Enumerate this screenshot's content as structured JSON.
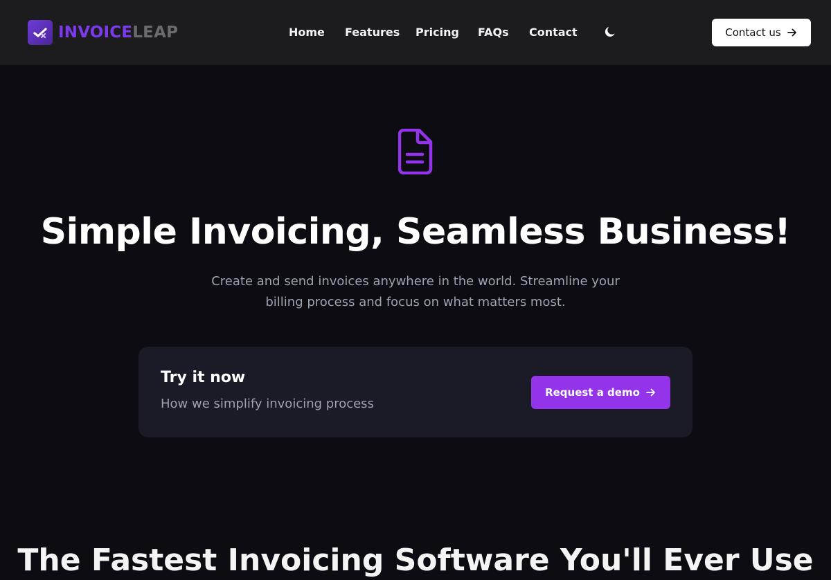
{
  "brand": {
    "name_part1": "INVOICE",
    "name_part2": "LEAP",
    "icon": "logo-mark-icon",
    "primary_color": "#7c3aed",
    "secondary_color": "#6b6b70"
  },
  "nav": {
    "links": [
      {
        "label": "Home"
      },
      {
        "label": "Features"
      },
      {
        "label": "Pricing"
      },
      {
        "label": "FAQs"
      },
      {
        "label": "Contact"
      }
    ],
    "theme_toggle_icon": "moon-icon",
    "contact_button": {
      "label": "Contact us",
      "icon": "arrow-right-icon"
    }
  },
  "hero": {
    "icon": "document-icon",
    "title": "Simple Invoicing, Seamless Business!",
    "subtitle_line1": "Create and send invoices anywhere in the world. Streamline your",
    "subtitle_line2": "billing process and focus on what matters most."
  },
  "cta": {
    "title": "Try it now",
    "subtitle": "How we simplify invoicing process",
    "button": {
      "label": "Request a demo",
      "icon": "arrow-right-icon"
    },
    "button_color": "#9333ea"
  },
  "next_section": {
    "heading_partial": "The Fastest Invoicing Software You'll Ever Use"
  },
  "colors": {
    "page_bg": "#0c0c12",
    "navbar_bg": "#1c1c1e",
    "card_bg": "#1a1b27",
    "muted_text": "#9ca3af"
  }
}
